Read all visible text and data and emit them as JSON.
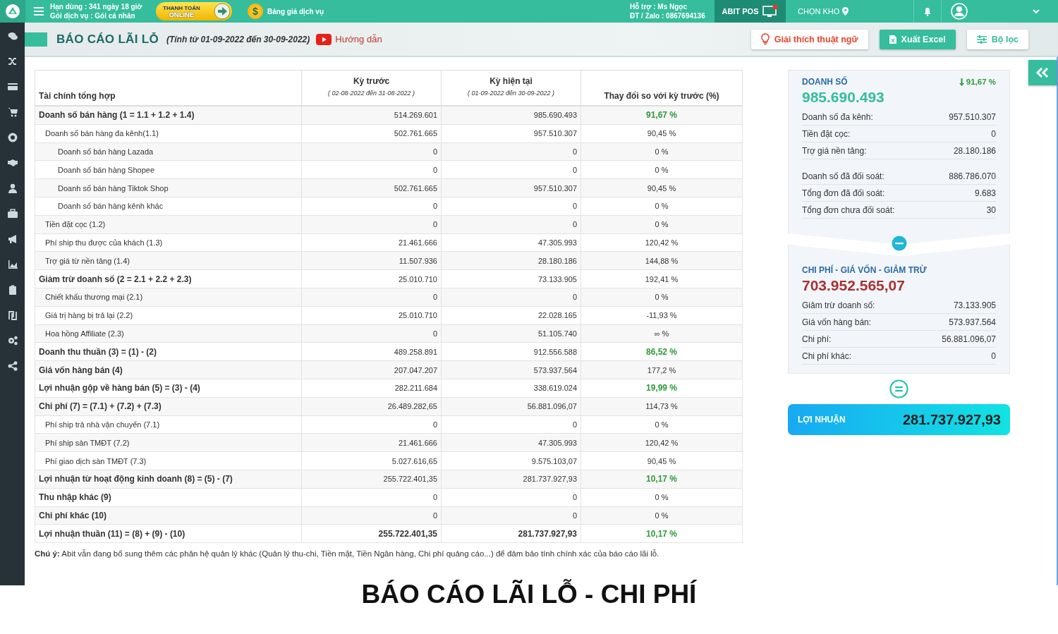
{
  "topbar": {
    "expiry": "Hạn dùng : 341 ngày 18 giờ",
    "plan": "Gói dịch vụ : Gói cá nhân",
    "pay_button": {
      "line1": "THANH TOÁN",
      "line2": "ONLINE"
    },
    "coin_symbol": "$",
    "pricing_link": "Bảng giá dịch vụ",
    "support": "Hỗ trợ : Ms Ngọc",
    "phone": "ĐT / Zalo : 0867694136",
    "pos_button": "ABIT POS",
    "warehouse": "CHỌN KHO"
  },
  "page_header": {
    "title": "BÁO CÁO LÃI LỖ",
    "period": "(Tính từ 01-09-2022 đến 30-09-2022)",
    "guide_link": "Hướng dẫn",
    "buttons": [
      {
        "kind": "glossary",
        "label": "Giải thích thuật ngữ"
      },
      {
        "kind": "excel",
        "label": "Xuất Excel"
      },
      {
        "kind": "filter",
        "label": "Bộ lọc"
      }
    ]
  },
  "table": {
    "columns": [
      {
        "title": "Tài chính tổng hợp"
      },
      {
        "title": "Kỳ trước",
        "subtitle": "( 02-08-2022 đến 31-08-2022 )"
      },
      {
        "title": "Kỳ hiện tại",
        "subtitle": "( 01-09-2022 đến 30-09-2022 )"
      },
      {
        "title": "Thay đổi so với kỳ trước (%)"
      }
    ],
    "rows": [
      {
        "kind": "main",
        "label": "Doanh số bán hàng (1 = 1.1 + 1.2 + 1.4)",
        "previous": "514.269.601",
        "current": "985.690.493",
        "change": "91,67 %",
        "highlight": true
      },
      {
        "kind": "sub",
        "label": "Doanh số bán hàng đa kênh(1.1)",
        "previous": "502.761.665",
        "current": "957.510.307",
        "change": "90,45 %",
        "highlight": false
      },
      {
        "kind": "item",
        "label": "Doanh số bán hàng Lazada",
        "previous": "0",
        "current": "0",
        "change": "0 %",
        "highlight": false
      },
      {
        "kind": "item",
        "label": "Doanh số bán hàng Shopee",
        "previous": "0",
        "current": "0",
        "change": "0 %",
        "highlight": false
      },
      {
        "kind": "item",
        "label": "Doanh số bán hàng Tiktok Shop",
        "previous": "502.761.665",
        "current": "957.510.307",
        "change": "90,45 %",
        "highlight": false
      },
      {
        "kind": "item",
        "label": "Doanh số bán hàng kênh khác",
        "previous": "0",
        "current": "0",
        "change": "0 %",
        "highlight": false
      },
      {
        "kind": "sub",
        "label": "Tiền đặt cọc (1.2)",
        "previous": "0",
        "current": "0",
        "change": "0 %",
        "highlight": false
      },
      {
        "kind": "sub",
        "label": "Phí ship thu được của khách (1.3)",
        "previous": "21.461.666",
        "current": "47.305.993",
        "change": "120,42 %",
        "highlight": false
      },
      {
        "kind": "sub",
        "label": "Trợ giá từ nền tảng (1.4)",
        "previous": "11.507.936",
        "current": "28.180.186",
        "change": "144,88 %",
        "highlight": false
      },
      {
        "kind": "main",
        "label": "Giảm trừ doanh số (2 = 2.1 + 2.2 + 2.3)",
        "previous": "25.010.710",
        "current": "73.133.905",
        "change": "192,41 %",
        "highlight": false
      },
      {
        "kind": "sub",
        "label": "Chiết khấu thương mại (2.1)",
        "previous": "0",
        "current": "0",
        "change": "0 %",
        "highlight": false
      },
      {
        "kind": "sub",
        "label": "Giá trị hàng bị trả lại (2.2)",
        "previous": "25.010.710",
        "current": "22.028.165",
        "change": "-11,93 %",
        "highlight": false
      },
      {
        "kind": "sub",
        "label": "Hoa hồng Affiliate (2.3)",
        "previous": "0",
        "current": "51.105.740",
        "change": "∞ %",
        "highlight": false
      },
      {
        "kind": "main",
        "label": "Doanh thu thuần (3) = (1) - (2)",
        "previous": "489.258.891",
        "current": "912.556.588",
        "change": "86,52 %",
        "highlight": true
      },
      {
        "kind": "main",
        "label": "Giá vốn hàng bán (4)",
        "previous": "207.047.207",
        "current": "573.937.564",
        "change": "177,2 %",
        "highlight": false
      },
      {
        "kind": "main",
        "label": "Lợi nhuận gộp về hàng bán (5) = (3) - (4)",
        "previous": "282.211.684",
        "current": "338.619.024",
        "change": "19,99 %",
        "highlight": true
      },
      {
        "kind": "main",
        "label": "Chi phí (7) = (7.1) + (7.2) + (7.3)",
        "previous": "26.489.282,65",
        "current": "56.881.096,07",
        "change": "114,73 %",
        "highlight": false
      },
      {
        "kind": "sub",
        "label": "Phí ship trả nhà vận chuyển (7.1)",
        "previous": "0",
        "current": "0",
        "change": "0 %",
        "highlight": false
      },
      {
        "kind": "sub",
        "label": "Phí ship sàn TMĐT (7.2)",
        "previous": "21.461.666",
        "current": "47.305.993",
        "change": "120,42 %",
        "highlight": false
      },
      {
        "kind": "sub",
        "label": "Phí giao dịch sàn TMĐT (7.3)",
        "previous": "5.027.616,65",
        "current": "9.575.103,07",
        "change": "90,45 %",
        "highlight": false
      },
      {
        "kind": "main",
        "label": "Lợi nhuận từ hoạt động kinh doanh (8) = (5) - (7)",
        "previous": "255.722.401,35",
        "current": "281.737.927,93",
        "change": "10,17 %",
        "highlight": true
      },
      {
        "kind": "main",
        "label": "Thu nhập khác (9)",
        "previous": "0",
        "current": "0",
        "change": "0 %",
        "highlight": false
      },
      {
        "kind": "main",
        "label": "Chi phí khác (10)",
        "previous": "0",
        "current": "0",
        "change": "0 %",
        "highlight": false
      },
      {
        "kind": "total",
        "label": "Lợi nhuận thuần (11) = (8) + (9) - (10)",
        "previous": "255.722.401,35",
        "current": "281.737.927,93",
        "change": "10,17 %",
        "highlight": true
      }
    ]
  },
  "note": "**Chú ý:** Abit vẫn đang bổ sung thêm các phân hệ quản lý khác (Quản lý thu-chi, Tiền mặt, Tiền Ngân hàng, Chi phí quảng cáo...) để đảm bảo tính chính xác của báo cáo lãi lỗ.",
  "summary": {
    "revenue": {
      "title": "DOANH SỐ",
      "change": "91,67 %",
      "value": "985.690.493",
      "groups": [
        [
          {
            "label": "Doanh số đa kênh:",
            "value": "957.510.307"
          },
          {
            "label": "Tiền đặt cọc:",
            "value": "0"
          },
          {
            "label": "Trợ giá nền tảng:",
            "value": "28.180.186"
          }
        ],
        [
          {
            "label": "Doanh số đã đối soát:",
            "value": "886.786.070"
          },
          {
            "label": "Tổng đơn đã đối soát:",
            "value": "9.683"
          },
          {
            "label": "Tổng đơn chưa đối soát:",
            "value": "30"
          }
        ]
      ]
    },
    "costs": {
      "title": "CHI PHÍ - GIÁ VỐN - GIẢM TRỪ",
      "value": "703.952.565,07",
      "lines": [
        {
          "label": "Giảm trừ doanh số:",
          "value": "73.133.905"
        },
        {
          "label": "Giá vốn hàng bán:",
          "value": "573.937.564"
        },
        {
          "label": "Chi phí:",
          "value": "56.881.096,07"
        },
        {
          "label": "Chi phí khác:",
          "value": "0"
        }
      ]
    },
    "profit": {
      "label": "LỢI NHUẬN",
      "value": "281.737.927,93"
    }
  },
  "caption": "BÁO CÁO LÃI LỖ - CHI PHÍ"
}
